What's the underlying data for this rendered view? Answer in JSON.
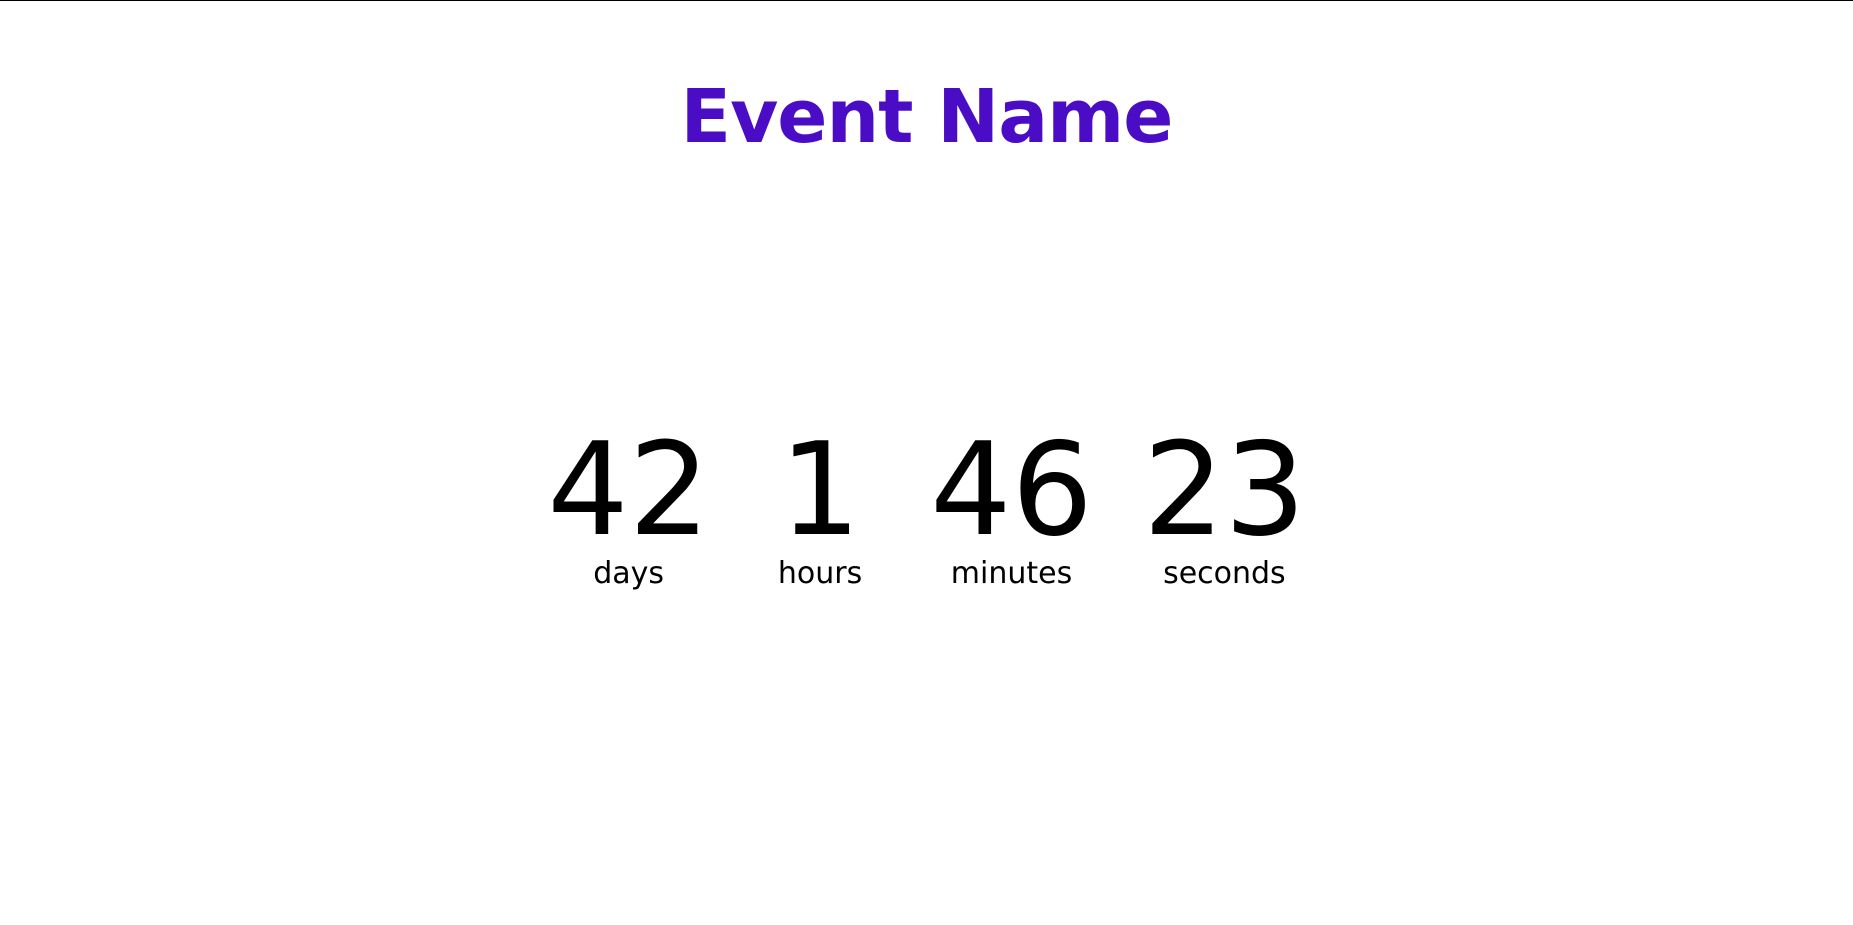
{
  "header": {
    "title": "Event Name"
  },
  "countdown": {
    "days": {
      "value": "42",
      "label": "days"
    },
    "hours": {
      "value": "1",
      "label": "hours"
    },
    "minutes": {
      "value": "46",
      "label": "minutes"
    },
    "seconds": {
      "value": "23",
      "label": "seconds"
    }
  },
  "colors": {
    "title": "#4a0cc4",
    "text": "#000000",
    "background": "#ffffff"
  }
}
